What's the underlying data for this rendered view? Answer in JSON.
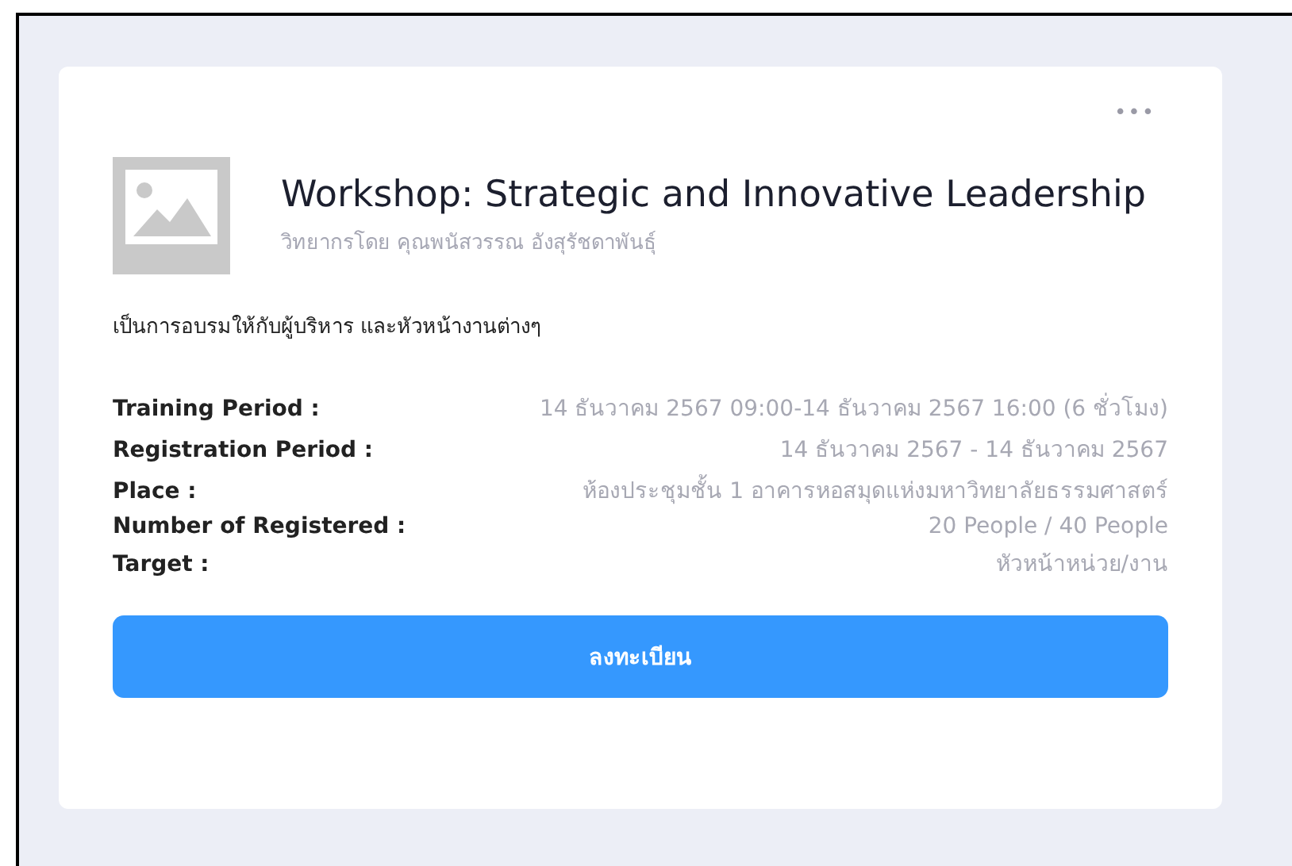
{
  "menu": {
    "icon": "•••"
  },
  "event": {
    "title": "Workshop: Strategic and Innovative Leadership",
    "speaker": "วิทยากรโดย คุณพนัสวรรณ อังสุรัชดาพันธุ์",
    "description": "เป็นการอบรมให้กับผู้บริหาร และหัวหน้างานต่างๆ"
  },
  "details": [
    {
      "label": "Training Period :",
      "value": "14 ธันวาคม 2567  09:00-14 ธันวาคม 2567  16:00 (6 ชั่วโมง)"
    },
    {
      "label": "Registration Period :",
      "value": "14 ธันวาคม 2567  - 14 ธันวาคม 2567"
    },
    {
      "label": "Place :",
      "value": "ห้องประชุมชั้น 1 อาคารหอสมุดแห่งมหาวิทยาลัยธรรมศาสตร์"
    },
    {
      "label": "Number of Registered :",
      "value": "20 People / 40 People"
    },
    {
      "label": "Target :",
      "value": "หัวหน้าหน่วย/งาน"
    }
  ],
  "button": {
    "label": "ลงทะเบียน"
  }
}
